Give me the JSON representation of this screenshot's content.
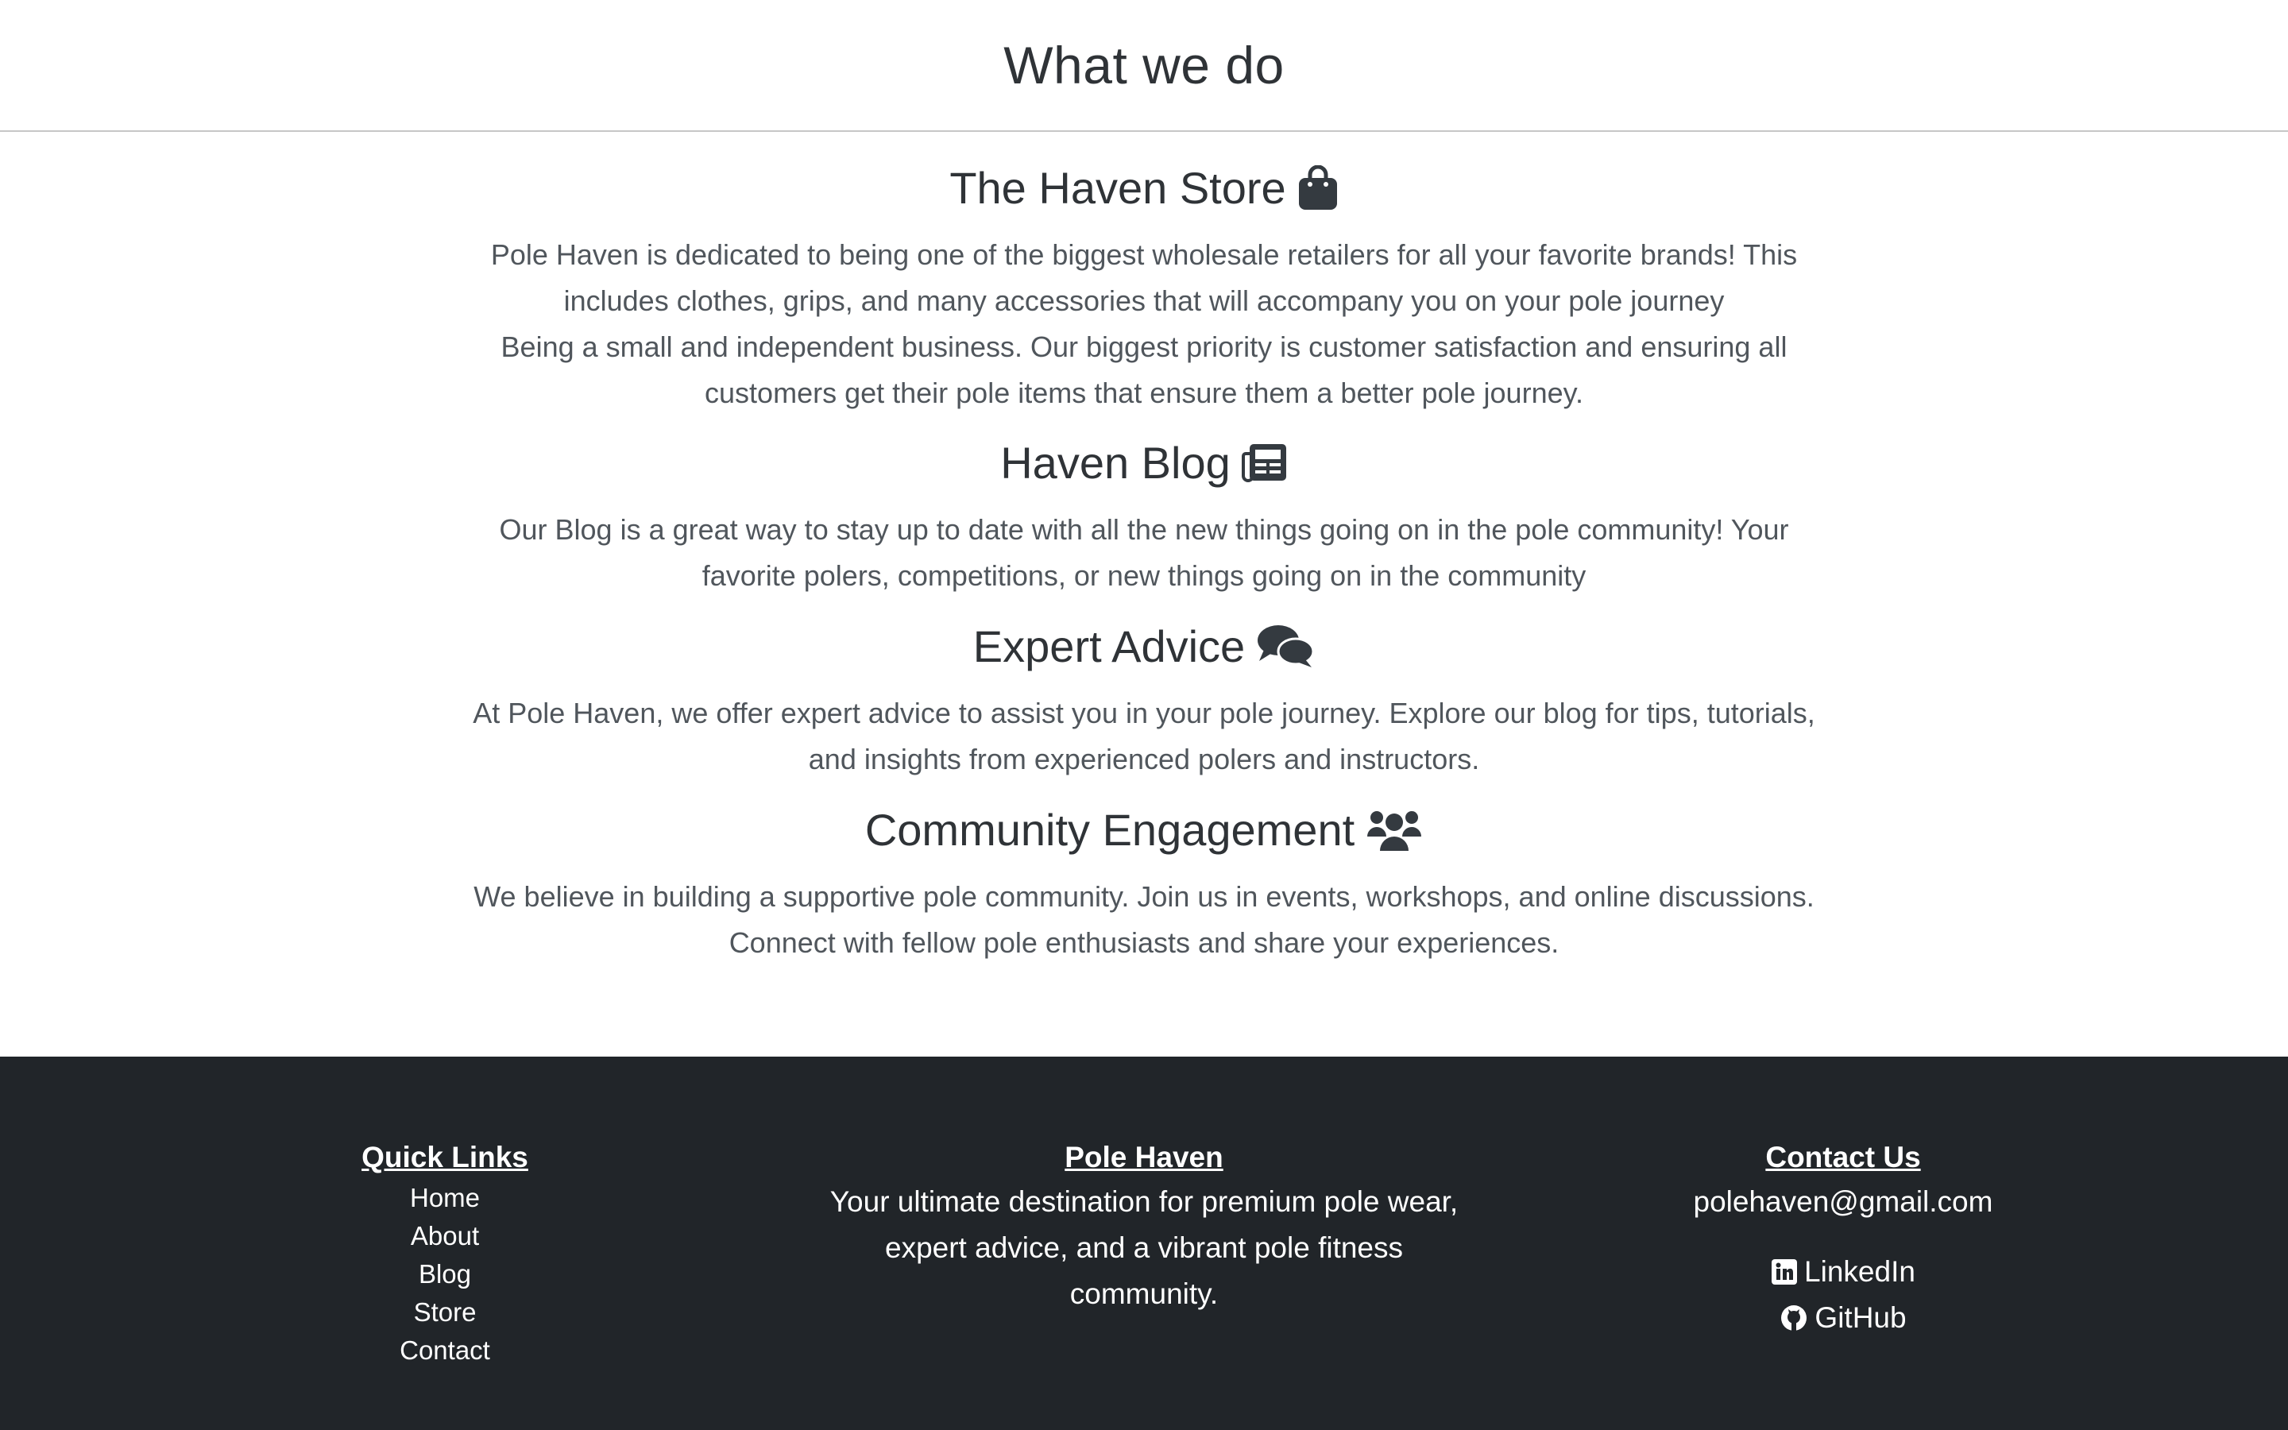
{
  "header": {
    "title": "What we do"
  },
  "sections": {
    "store": {
      "title": "The Haven Store",
      "icon": "shopping-bag-icon",
      "text1": "Pole Haven is dedicated to being one of the biggest wholesale retailers for all your favorite brands! This includes clothes, grips, and many accessories that will accompany you on your pole journey",
      "text2": "Being a small and independent business. Our biggest priority is customer satisfaction and ensuring all customers get their pole items that ensure them a better pole journey."
    },
    "blog": {
      "title": "Haven Blog",
      "icon": "newspaper-icon",
      "text": "Our Blog is a great way to stay up to date with all the new things going on in the pole community! Your favorite polers, competitions, or new things going on in the community"
    },
    "advice": {
      "title": "Expert Advice",
      "icon": "comments-icon",
      "text": "At Pole Haven, we offer expert advice to assist you in your pole journey. Explore our blog for tips, tutorials, and insights from experienced polers and instructors."
    },
    "community": {
      "title": "Community Engagement",
      "icon": "users-icon",
      "text": "We believe in building a supportive pole community. Join us in events, workshops, and online discussions. Connect with fellow pole enthusiasts and share your experiences."
    }
  },
  "footer": {
    "quick_links": {
      "title": "Quick Links",
      "items": [
        "Home",
        "About",
        "Blog",
        "Store",
        "Contact"
      ]
    },
    "about": {
      "title": "Pole Haven",
      "text": "Your ultimate destination for premium pole wear, expert advice, and a vibrant pole fitness community."
    },
    "contact": {
      "title": "Contact Us",
      "email": "polehaven@gmail.com",
      "linkedin": "LinkedIn",
      "github": "GitHub"
    }
  },
  "colors": {
    "heading": "#2f3337",
    "body_text": "#50565c",
    "footer_bg": "#212529",
    "footer_text": "#ffffff"
  }
}
